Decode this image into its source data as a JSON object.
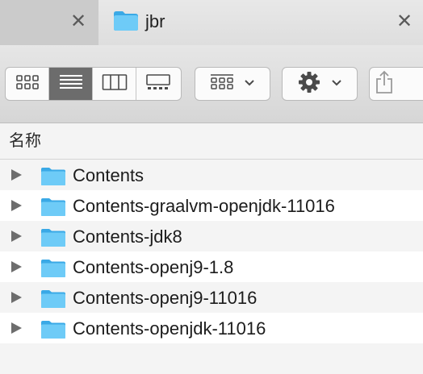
{
  "tabs": {
    "inactive": {
      "close_glyph": "✕"
    },
    "active": {
      "title": "jbr",
      "icon": "folder-icon",
      "close_glyph": "✕"
    }
  },
  "toolbar": {
    "view_modes": [
      {
        "name": "icon-view",
        "icon": "grid-icon",
        "active": false
      },
      {
        "name": "list-view",
        "icon": "list-icon",
        "active": true
      },
      {
        "name": "column-view",
        "icon": "columns-icon",
        "active": false
      },
      {
        "name": "gallery-view",
        "icon": "gallery-icon",
        "active": false
      }
    ],
    "group_button": {
      "icon": "group-grid-icon"
    },
    "action_button": {
      "icon": "gear-icon"
    },
    "share_button": {
      "icon": "share-icon"
    }
  },
  "header": {
    "name_column": "名称"
  },
  "rows": [
    {
      "name": "Contents"
    },
    {
      "name": "Contents-graalvm-openjdk-11016"
    },
    {
      "name": "Contents-jdk8"
    },
    {
      "name": "Contents-openj9-1.8"
    },
    {
      "name": "Contents-openj9-11016"
    },
    {
      "name": "Contents-openjdk-11016"
    }
  ],
  "colors": {
    "folder": "#5bc3f5",
    "folder_dark": "#3aa9e6",
    "selected_segment": "#6c6c6c"
  }
}
